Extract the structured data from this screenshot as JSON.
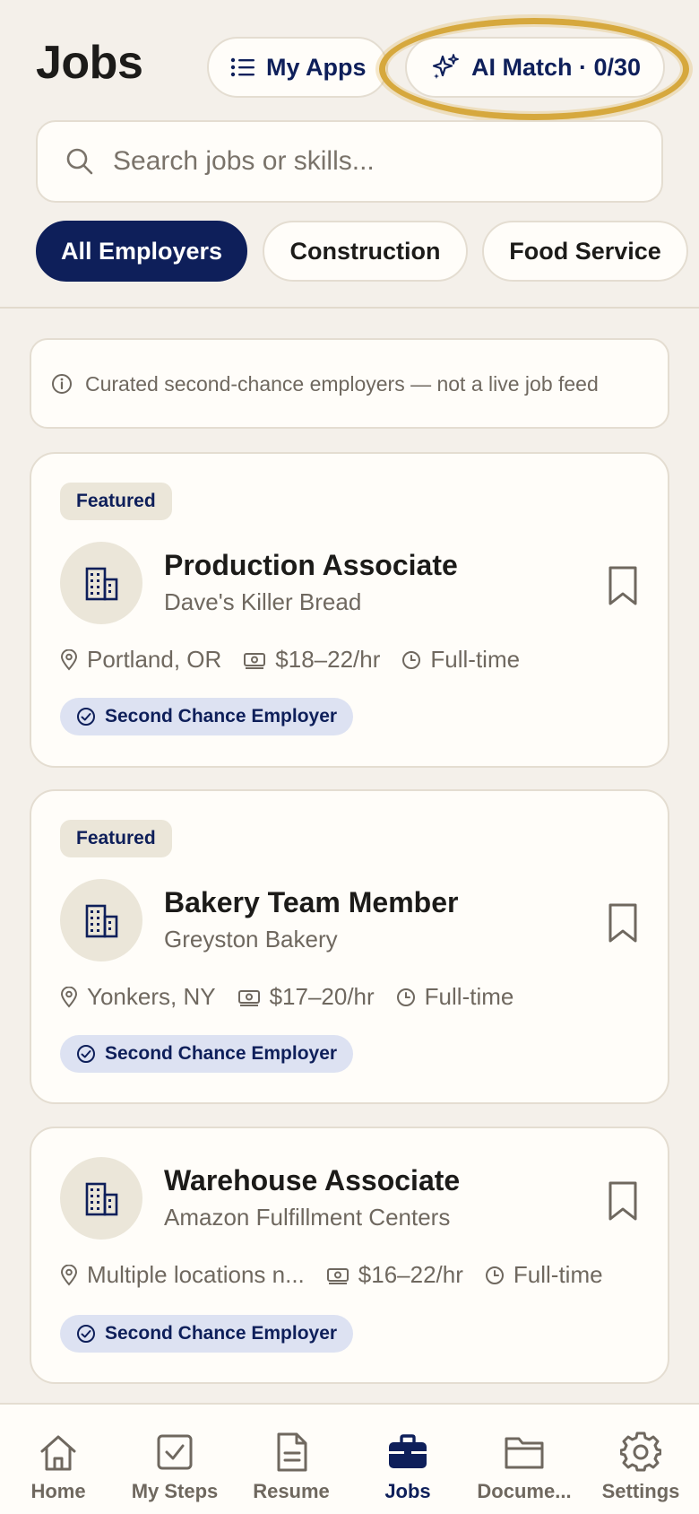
{
  "header": {
    "title": "Jobs",
    "my_apps_label": "My Apps",
    "ai_match_label": "AI Match · 0/30"
  },
  "search": {
    "placeholder": "Search jobs or skills..."
  },
  "filters": [
    {
      "label": "All Employers",
      "active": true
    },
    {
      "label": "Construction",
      "active": false
    },
    {
      "label": "Food Service",
      "active": false
    }
  ],
  "notice": {
    "text": "Curated second-chance employers — not a live job feed"
  },
  "jobs": [
    {
      "featured": "Featured",
      "title": "Production Associate",
      "company": "Dave's Killer Bread",
      "location": "Portland, OR",
      "pay": "$18–22/hr",
      "type": "Full-time",
      "badge": "Second Chance Employer"
    },
    {
      "featured": "Featured",
      "title": "Bakery Team Member",
      "company": "Greyston Bakery",
      "location": "Yonkers, NY",
      "pay": "$17–20/hr",
      "type": "Full-time",
      "badge": "Second Chance Employer"
    },
    {
      "title": "Warehouse Associate",
      "company": "Amazon Fulfillment Centers",
      "location": "Multiple locations n...",
      "pay": "$16–22/hr",
      "type": "Full-time",
      "badge": "Second Chance Employer"
    }
  ],
  "tabbar": [
    {
      "label": "Home",
      "icon": "home-icon"
    },
    {
      "label": "My Steps",
      "icon": "checkbox-icon"
    },
    {
      "label": "Resume",
      "icon": "document-icon"
    },
    {
      "label": "Jobs",
      "icon": "briefcase-icon",
      "active": true
    },
    {
      "label": "Docume...",
      "icon": "folder-icon"
    },
    {
      "label": "Settings",
      "icon": "gear-icon"
    }
  ],
  "colors": {
    "background": "#f4f0ea",
    "card": "#fffdf9",
    "navy": "#0e1f5a",
    "highlight": "#d6a83d",
    "muted_text": "#6f685f",
    "badge_bg": "#dde2f2"
  }
}
